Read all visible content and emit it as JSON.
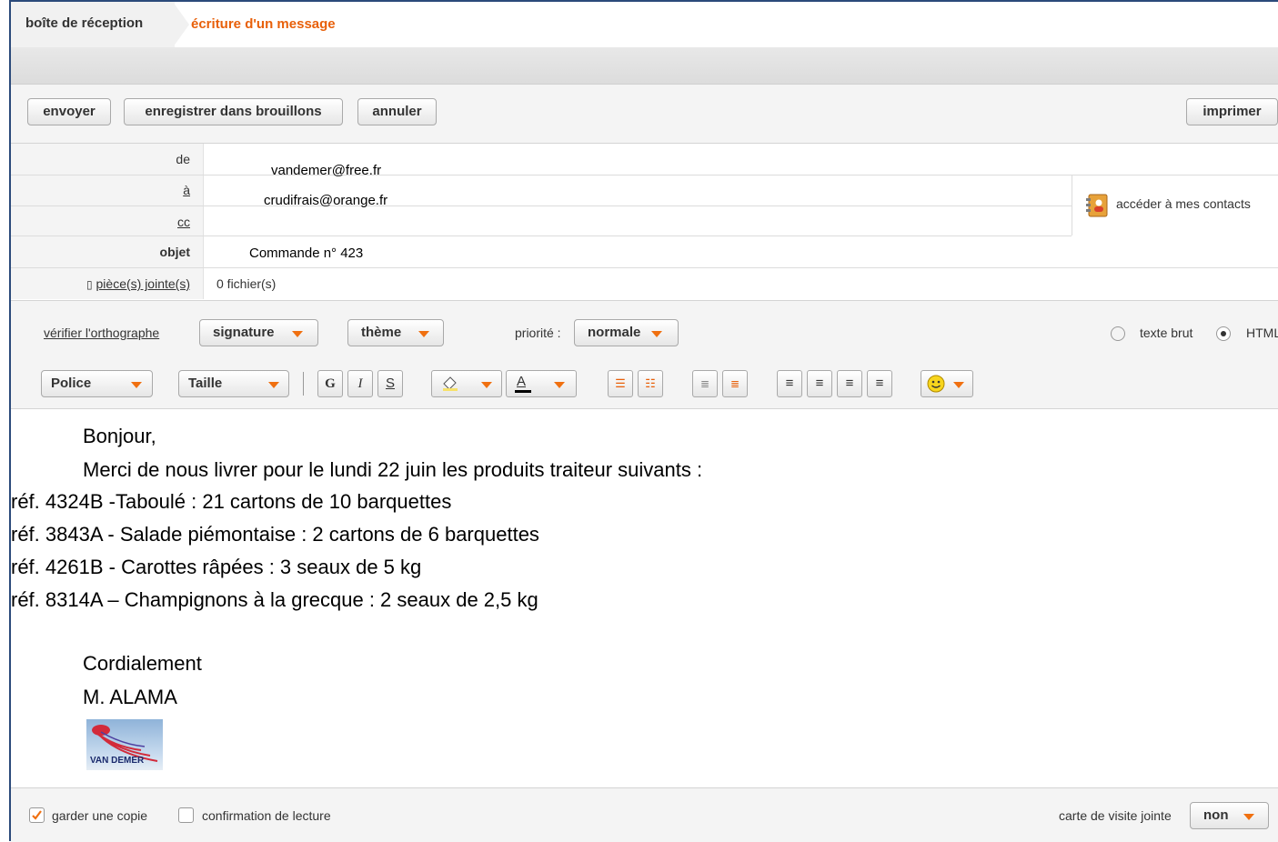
{
  "breadcrumb": {
    "inbox": "boîte de réception",
    "compose": "écriture d'un message"
  },
  "toolbar": {
    "send": "envoyer",
    "save_draft": "enregistrer dans brouillons",
    "cancel": "annuler",
    "print": "imprimer"
  },
  "header": {
    "from_label": "de",
    "from_value": "vandemer@free.fr",
    "to_label": "à",
    "to_value": "crudifrais@orange.fr",
    "cc_label": "cc",
    "cc_value": "",
    "subject_label": "objet",
    "subject_value": "Commande n° 423",
    "attach_label": "pièce(s) jointe(s)",
    "attach_value": "0 fichier(s)",
    "contacts_label": "accéder à mes contacts"
  },
  "options": {
    "spellcheck": "vérifier l'orthographe",
    "signature": "signature",
    "theme": "thème",
    "priority_label": "priorité :",
    "priority_value": "normale",
    "plain_text": "texte brut",
    "html": "HTML",
    "selected_format": "HTML"
  },
  "editor_toolbar": {
    "font": "Police",
    "size": "Taille",
    "bold": "G",
    "italic": "I",
    "underline": "S"
  },
  "message": {
    "greeting": "Bonjour,",
    "intro": "Merci de nous livrer pour le lundi 22 juin les produits traiteur suivants :",
    "items": [
      "réf. 4324B -Taboulé : 21 cartons de 10 barquettes",
      "réf. 3843A - Salade piémontaise : 2 cartons de 6 barquettes",
      "réf. 4261B - Carottes râpées : 3 seaux de 5 kg",
      "réf. 8314A – Champignons à la grecque : 2 seaux de 2,5 kg"
    ],
    "closing": "Cordialement",
    "signature": "M. ALAMA",
    "logo_text": "VAN DEMER"
  },
  "footer": {
    "keep_copy": "garder une copie",
    "keep_copy_checked": true,
    "read_receipt": "confirmation de lecture",
    "read_receipt_checked": false,
    "card_label": "carte de visite jointe",
    "card_value": "non"
  },
  "colors": {
    "accent": "#e8600a",
    "frame": "#2b4a7a"
  }
}
